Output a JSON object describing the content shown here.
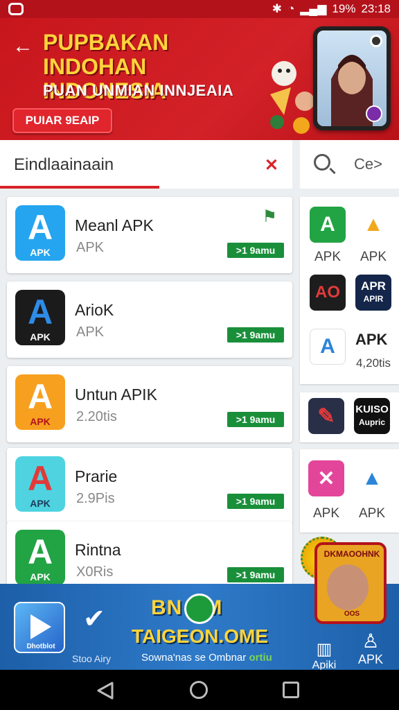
{
  "status_bar": {
    "battery": "19%",
    "time": "23:18"
  },
  "banner": {
    "title": "PUPBAKAN INDOHAN INDONESIA",
    "subtitle": "PUAN UNMIAN INNJEAIA",
    "button_label": "PUIAR 9EAIP"
  },
  "search": {
    "query": "Eindlaainaain",
    "right_hint": "Ce>"
  },
  "apps": [
    {
      "name": "Meanl APK",
      "meta": "APK",
      "badge": ">1 9amu",
      "icon_text": "APK",
      "icon_color": "#25a5ef"
    },
    {
      "name": "ArioK",
      "meta": "APK",
      "badge": ">1 9amu",
      "icon_text": "APK",
      "icon_color": "#1b1b1b"
    },
    {
      "name": "Untun APIK",
      "meta": "2.20tis",
      "badge": ">1 9amu",
      "icon_text": "APK",
      "icon_color": "#f7a01f"
    },
    {
      "name": "Prarie",
      "meta": "2.9Pis",
      "badge": ">1 9amu",
      "icon_text": "APK",
      "icon_color": "#4fd3e0"
    },
    {
      "name": "Rintna",
      "meta": "X0Ris",
      "badge": ">1 9amu",
      "icon_text": "APK",
      "icon_color": "#22a344"
    }
  ],
  "side_grid": {
    "group1": [
      {
        "label": "APK",
        "icon_color": "#22a344"
      },
      {
        "label": "APK",
        "icon_color": "#f2a81c"
      },
      {
        "label": "",
        "icon_color": "#1d1d1d"
      },
      {
        "label": "",
        "icon_color": "#14264a"
      },
      {
        "label": "",
        "icon_color": "#2b85d8"
      },
      {
        "label": "4,20tis",
        "icon_color": "#ffffff"
      }
    ],
    "group2": [
      {
        "label": "",
        "icon_color": "#2a2f48"
      },
      {
        "label": "",
        "icon_color": "#111111"
      }
    ],
    "group3": [
      {
        "label": "APK",
        "icon_color": "#e3459a"
      },
      {
        "label": "APK",
        "icon_color": "#ffffff"
      }
    ],
    "mini_text": {
      "apr": "APR",
      "apr_sub": "APIR",
      "apk_top": "APK",
      "kuiso": "KUISO",
      "aupric": "Aupric"
    }
  },
  "promo": {
    "title": "BN  NM",
    "domain": "TAIGEON.OME",
    "tagline": "Sowna'nas se Ombnar",
    "tagline_green": "ortiu",
    "left_icon_label": "Dhotblot",
    "mid_label": "Stoo Airy",
    "right_a_label": "Apiki",
    "right_b_label": "APK"
  },
  "sticker": {
    "title": "DKMAOOHNK",
    "foot": "OOS"
  }
}
